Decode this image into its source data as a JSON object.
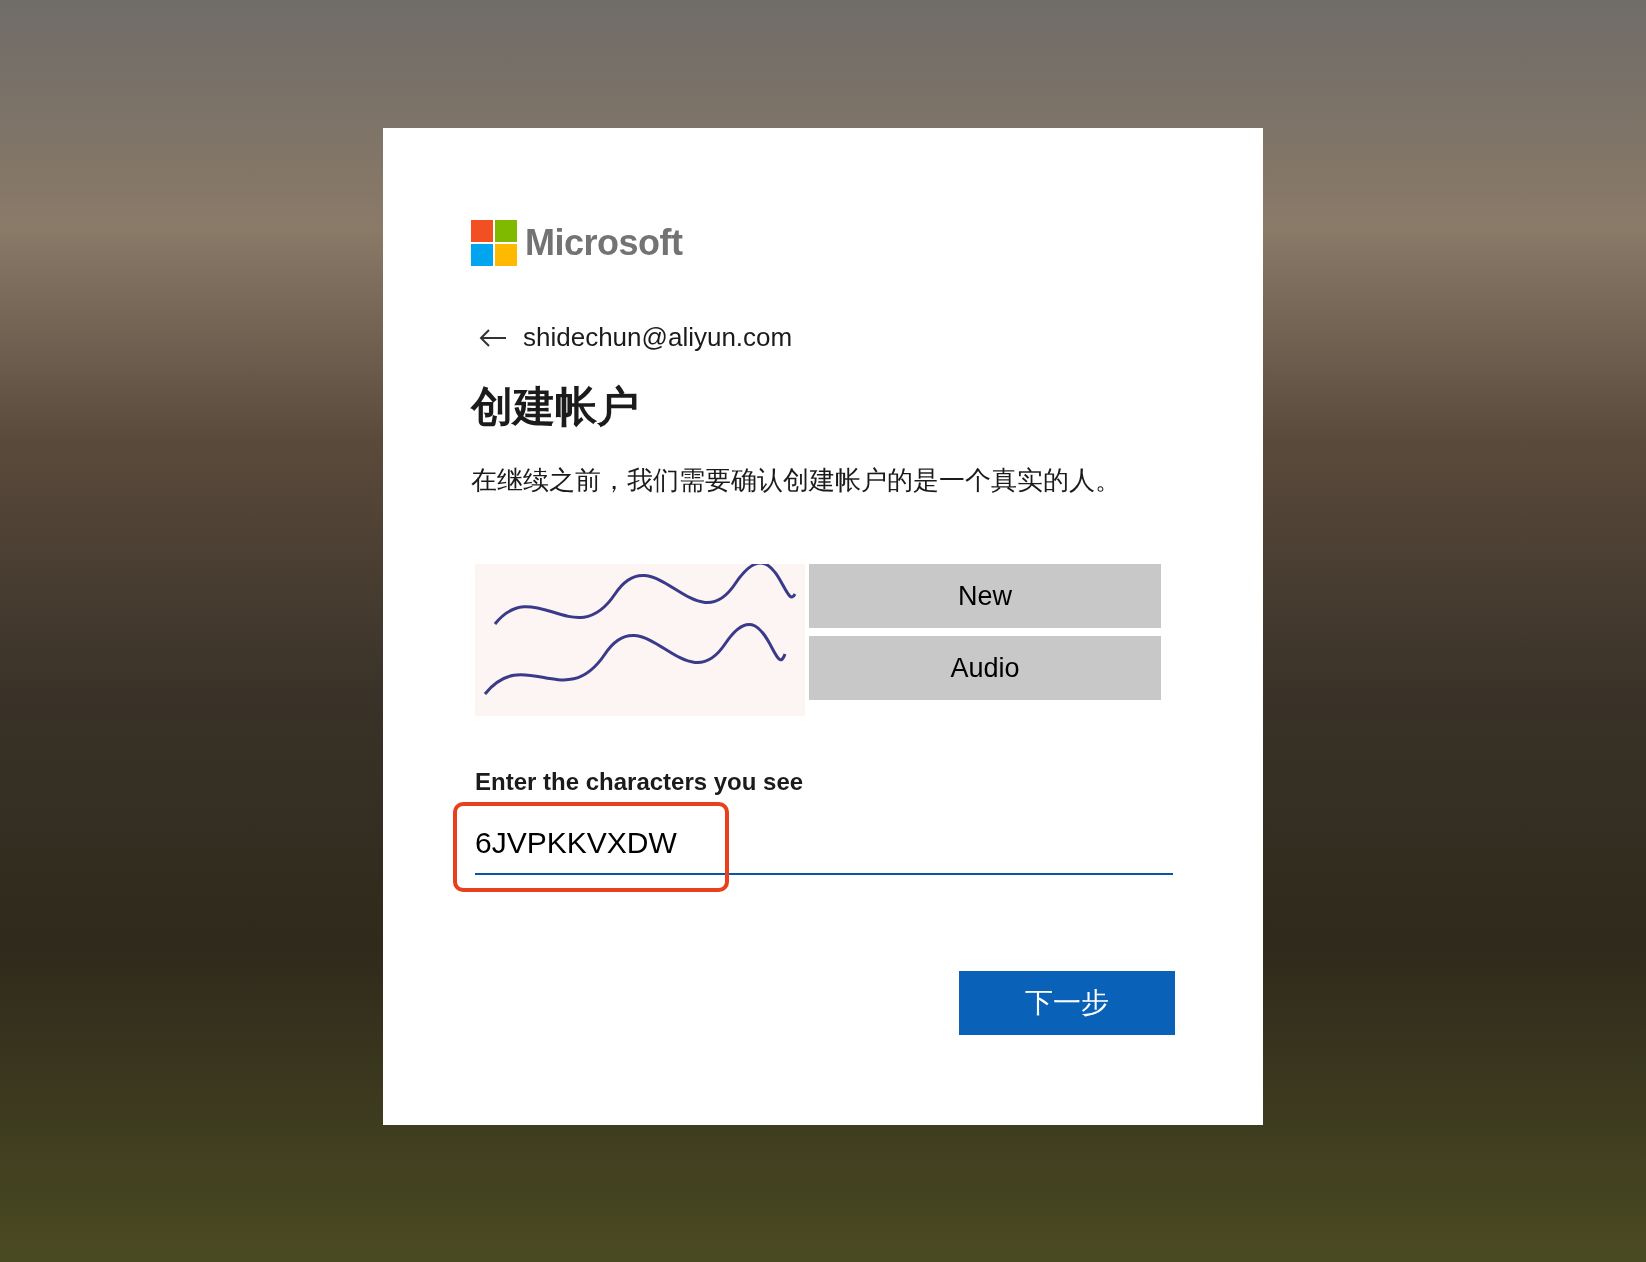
{
  "logo": {
    "text": "Microsoft"
  },
  "account": {
    "email": "shidechun@aliyun.com"
  },
  "title": "创建帐户",
  "description": "在继续之前，我们需要确认创建帐户的是一个真实的人。",
  "captcha": {
    "buttons": [
      "New",
      "Audio"
    ],
    "label": "Enter the characters you see",
    "value": "6JVPKKVXDW",
    "highlighted": true
  },
  "next_button": "下一步"
}
